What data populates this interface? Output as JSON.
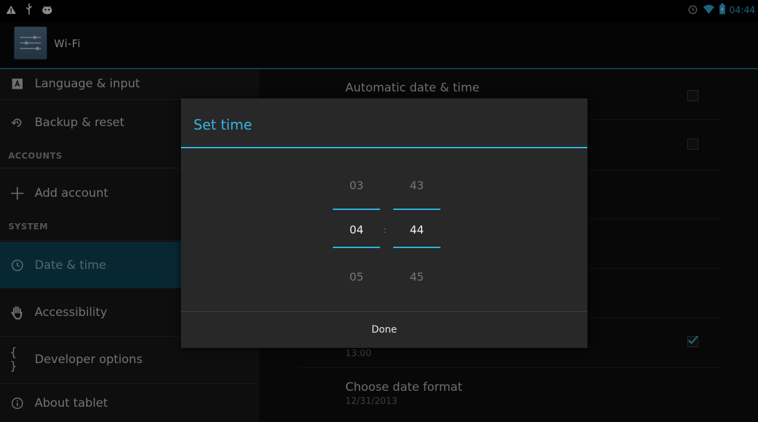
{
  "status_bar": {
    "left_icons": [
      "warning-icon",
      "usb-icon",
      "android-debug-icon"
    ],
    "right_icons": [
      "alarm-icon",
      "wifi-icon",
      "battery-icon"
    ],
    "time": "04:44"
  },
  "action_bar": {
    "title": "Wi-Fi",
    "icon": "settings-icon"
  },
  "left_menu": {
    "items": [
      {
        "label": "Language & input",
        "icon": "keyboard-icon"
      },
      {
        "label": "Backup & reset",
        "icon": "backup-icon"
      },
      {
        "label": "Add account",
        "icon": "plus-icon"
      },
      {
        "label": "Date & time",
        "icon": "clock-icon",
        "selected": true
      },
      {
        "label": "Accessibility",
        "icon": "hand-icon"
      },
      {
        "label": "Developer options",
        "icon": "braces-icon"
      },
      {
        "label": "About tablet",
        "icon": "info-icon"
      }
    ],
    "sections": {
      "accounts": "ACCOUNTS",
      "system": "SYSTEM"
    }
  },
  "right_panel": {
    "auto_title": "Automatic date & time",
    "time_sub": "13:00",
    "date_format_title": "Choose date format",
    "date_format_sub": "12/31/2013",
    "checked_24h": true
  },
  "dialog": {
    "title": "Set time",
    "hours": {
      "prev": "03",
      "current": "04",
      "next": "05"
    },
    "minutes": {
      "prev": "43",
      "current": "44",
      "next": "45"
    },
    "separator": ":",
    "done_label": "Done"
  },
  "colors": {
    "accent": "#33b5e5",
    "selected_bg": "#0e4a5e",
    "dialog_bg": "#282828"
  }
}
